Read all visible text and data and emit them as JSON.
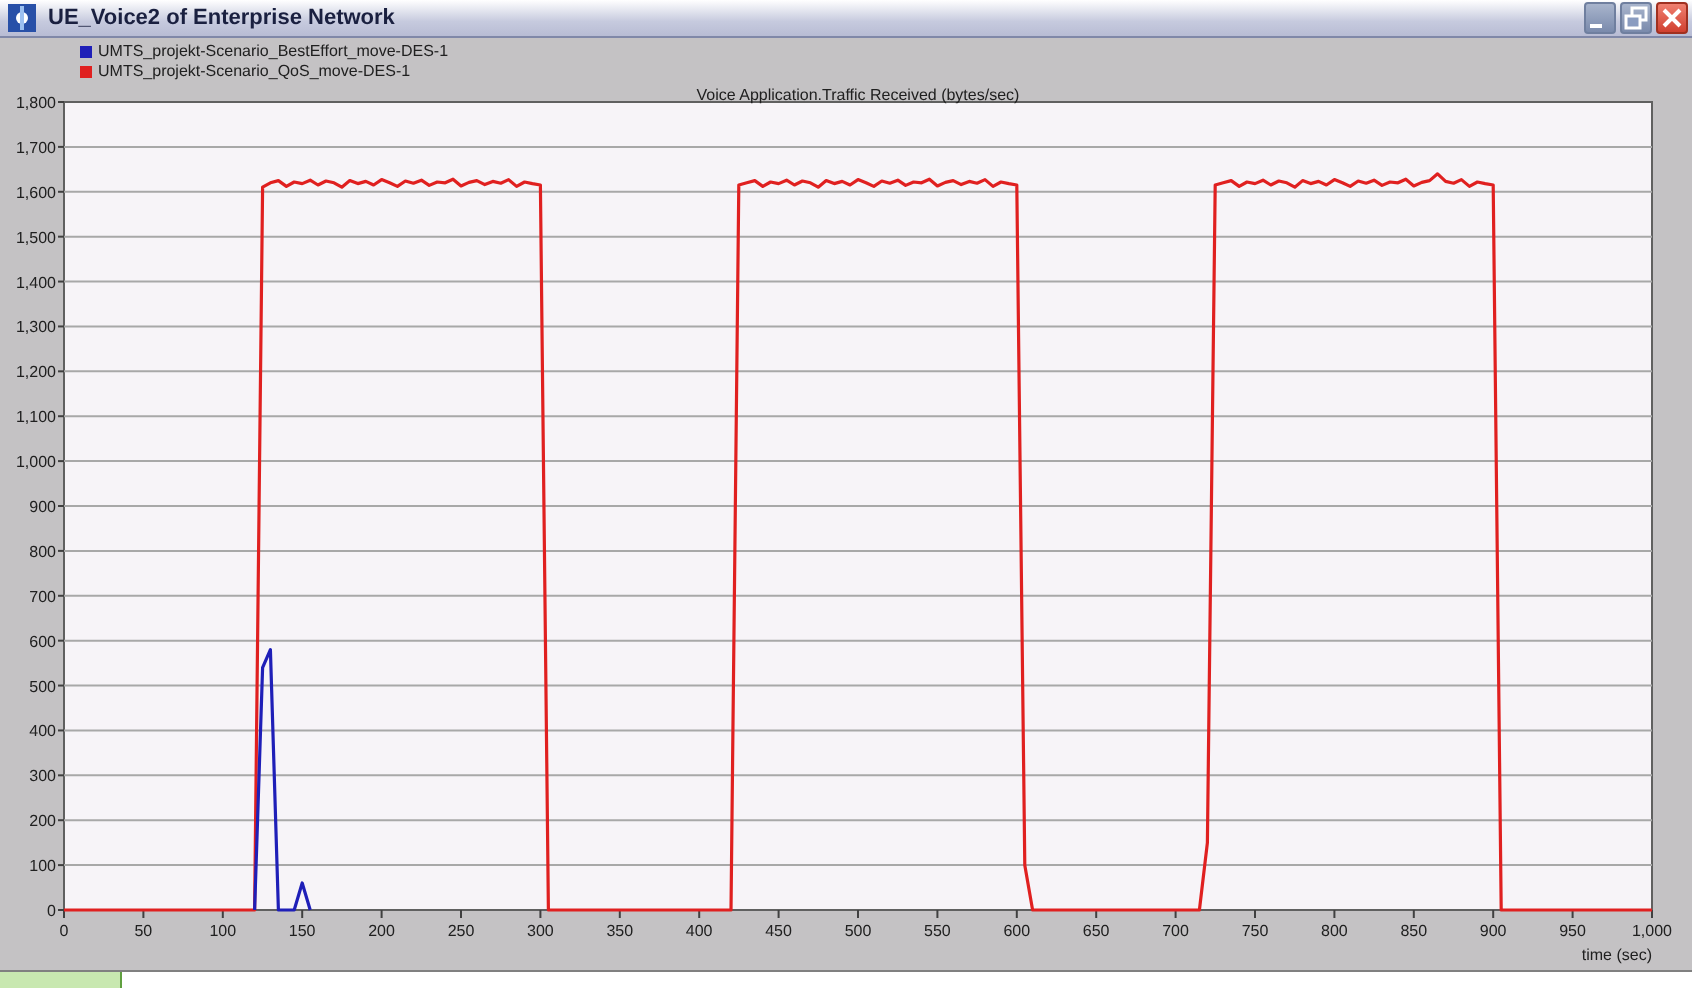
{
  "window": {
    "title": "UE_Voice2 of Enterprise Network"
  },
  "chart": {
    "chart_data": {
      "type": "line",
      "grid": true,
      "title": "Voice Application.Traffic Received (bytes/sec)",
      "xlabel": "time (sec)",
      "x": [
        0,
        5,
        10,
        15,
        20,
        25,
        30,
        35,
        40,
        45,
        50,
        55,
        60,
        65,
        70,
        75,
        80,
        85,
        90,
        95,
        100,
        105,
        110,
        115,
        120,
        125,
        130,
        135,
        140,
        145,
        150,
        155,
        160,
        165,
        170,
        175,
        180,
        185,
        190,
        195,
        200,
        205,
        210,
        215,
        220,
        225,
        230,
        235,
        240,
        245,
        250,
        255,
        260,
        265,
        270,
        275,
        280,
        285,
        290,
        295,
        300,
        305,
        310,
        315,
        320,
        325,
        330,
        335,
        340,
        345,
        350,
        355,
        360,
        365,
        370,
        375,
        380,
        385,
        390,
        395,
        400,
        405,
        410,
        415,
        420,
        425,
        430,
        435,
        440,
        445,
        450,
        455,
        460,
        465,
        470,
        475,
        480,
        485,
        490,
        495,
        500,
        505,
        510,
        515,
        520,
        525,
        530,
        535,
        540,
        545,
        550,
        555,
        560,
        565,
        570,
        575,
        580,
        585,
        590,
        595,
        600,
        605,
        610,
        615,
        620,
        625,
        630,
        635,
        640,
        645,
        650,
        655,
        660,
        665,
        670,
        675,
        680,
        685,
        690,
        695,
        700,
        705,
        710,
        715,
        720,
        725,
        730,
        735,
        740,
        745,
        750,
        755,
        760,
        765,
        770,
        775,
        780,
        785,
        790,
        795,
        800,
        805,
        810,
        815,
        820,
        825,
        830,
        835,
        840,
        845,
        850,
        855,
        860,
        865,
        870,
        875,
        880,
        885,
        890,
        895,
        900,
        905,
        910,
        915,
        920,
        925,
        930,
        935,
        940,
        945,
        950,
        955,
        960,
        965,
        970,
        975,
        980,
        985,
        990,
        995,
        1000
      ],
      "series": [
        {
          "name": "UMTS_projekt-Scenario_BestEffort_move-DES-1",
          "color": "#1f1fb8",
          "values": [
            null,
            null,
            null,
            null,
            null,
            null,
            null,
            null,
            null,
            null,
            null,
            null,
            null,
            null,
            null,
            null,
            null,
            null,
            null,
            null,
            null,
            null,
            null,
            null,
            0,
            540,
            580,
            0,
            0,
            0,
            60,
            0,
            null,
            null,
            null,
            null,
            null,
            null,
            null,
            null,
            null,
            null,
            null,
            null,
            null,
            null,
            null,
            null,
            null,
            null,
            null,
            null,
            null,
            null,
            null,
            null,
            null,
            null,
            null,
            null,
            null,
            null,
            null,
            null,
            null,
            null,
            null,
            null,
            null,
            null,
            null,
            null,
            null,
            null,
            null,
            null,
            null,
            null,
            null,
            null,
            null,
            null,
            null,
            null,
            null,
            null,
            null,
            null,
            null,
            null,
            null,
            null,
            null,
            null,
            null,
            null,
            null,
            null,
            null,
            null,
            null,
            null,
            null,
            null,
            null,
            null,
            null,
            null,
            null,
            null,
            null,
            null,
            null,
            null,
            null,
            null,
            null,
            null,
            null,
            null,
            null,
            null,
            null,
            null,
            null,
            null,
            null,
            null,
            null,
            null,
            null,
            null,
            null,
            null,
            null,
            null,
            null,
            null,
            null,
            null,
            null,
            null,
            null,
            null,
            null,
            null,
            null,
            null,
            null,
            null,
            null,
            null,
            null,
            null,
            null,
            null,
            null,
            null,
            null,
            null,
            null,
            null,
            null,
            null,
            null,
            null,
            null,
            null,
            null,
            null,
            null,
            null,
            null,
            null,
            null,
            null,
            null,
            null,
            null,
            null,
            null,
            null,
            null,
            null,
            null,
            null,
            null,
            null,
            null,
            null,
            null,
            null,
            null,
            null,
            null,
            null,
            null,
            null,
            null,
            null,
            null
          ]
        },
        {
          "name": "UMTS_projekt-Scenario_QoS_move-DES-1",
          "color": "#e02020",
          "values": [
            0,
            0,
            0,
            0,
            0,
            0,
            0,
            0,
            0,
            0,
            0,
            0,
            0,
            0,
            0,
            0,
            0,
            0,
            0,
            0,
            0,
            0,
            0,
            0,
            0,
            1610,
            1620,
            1625,
            1612,
            1622,
            1618,
            1626,
            1615,
            1624,
            1620,
            1610,
            1625,
            1618,
            1623,
            1615,
            1627,
            1620,
            1612,
            1624,
            1619,
            1626,
            1614,
            1622,
            1620,
            1628,
            1613,
            1621,
            1625,
            1616,
            1623,
            1619,
            1627,
            1612,
            1622,
            1618,
            1615,
            0,
            0,
            0,
            0,
            0,
            0,
            0,
            0,
            0,
            0,
            0,
            0,
            0,
            0,
            0,
            0,
            0,
            0,
            0,
            0,
            0,
            0,
            0,
            0,
            1615,
            1620,
            1625,
            1612,
            1622,
            1618,
            1626,
            1615,
            1624,
            1620,
            1610,
            1625,
            1618,
            1623,
            1615,
            1627,
            1620,
            1612,
            1624,
            1619,
            1626,
            1614,
            1622,
            1620,
            1628,
            1613,
            1621,
            1625,
            1616,
            1623,
            1619,
            1627,
            1612,
            1622,
            1618,
            1615,
            100,
            0,
            0,
            0,
            0,
            0,
            0,
            0,
            0,
            0,
            0,
            0,
            0,
            0,
            0,
            0,
            0,
            0,
            0,
            0,
            0,
            0,
            0,
            150,
            1615,
            1620,
            1625,
            1612,
            1622,
            1618,
            1626,
            1615,
            1624,
            1620,
            1610,
            1625,
            1618,
            1623,
            1615,
            1627,
            1620,
            1612,
            1624,
            1619,
            1626,
            1614,
            1622,
            1620,
            1628,
            1613,
            1621,
            1625,
            1640,
            1623,
            1619,
            1627,
            1612,
            1622,
            1618,
            1615,
            0,
            0,
            0,
            0,
            0,
            0,
            0,
            0,
            0,
            0,
            0,
            0,
            0,
            0,
            0,
            0,
            0,
            0,
            0,
            0
          ]
        }
      ],
      "xlim": [
        0,
        1000
      ],
      "ylim": [
        0,
        1800
      ],
      "xticks": [
        0,
        50,
        100,
        150,
        200,
        250,
        300,
        350,
        400,
        450,
        500,
        550,
        600,
        650,
        700,
        750,
        800,
        850,
        900,
        950,
        {
          "value": 1000,
          "label": "1,000"
        }
      ],
      "yticks": [
        0,
        100,
        200,
        300,
        400,
        500,
        600,
        700,
        800,
        900,
        {
          "value": 1000,
          "label": "1,000"
        },
        {
          "value": 1100,
          "label": "1,100"
        },
        {
          "value": 1200,
          "label": "1,200"
        },
        {
          "value": 1300,
          "label": "1,300"
        },
        {
          "value": 1400,
          "label": "1,400"
        },
        {
          "value": 1500,
          "label": "1,500"
        },
        {
          "value": 1600,
          "label": "1,600"
        },
        {
          "value": 1700,
          "label": "1,700"
        },
        {
          "value": 1800,
          "label": "1,800"
        }
      ]
    }
  }
}
